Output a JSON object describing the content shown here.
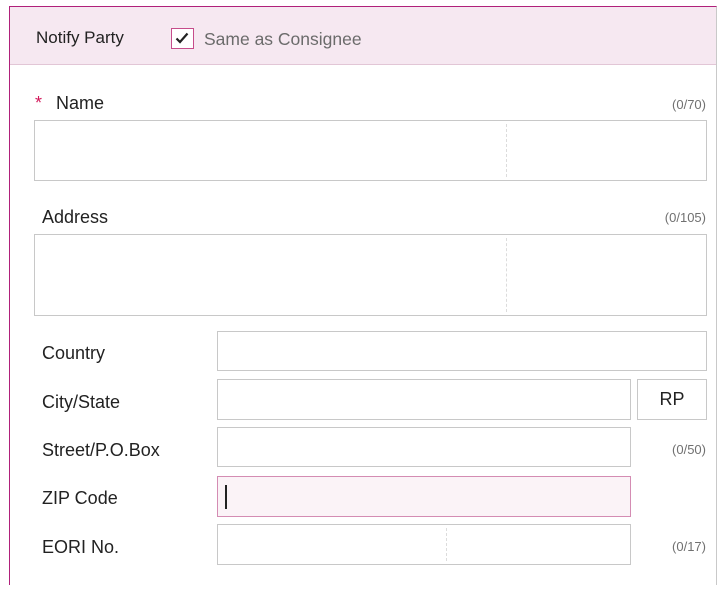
{
  "header": {
    "section_label": "Notify Party",
    "checkbox_label": "Same as Consignee",
    "checkbox_checked": true
  },
  "name": {
    "required_mark": "*",
    "label": "Name",
    "counter": "(0/70)",
    "value": ""
  },
  "address": {
    "label": "Address",
    "counter": "(0/105)",
    "value": ""
  },
  "country": {
    "label": "Country",
    "value": ""
  },
  "city_state": {
    "label": "City/State",
    "value": "",
    "state_value": "RP"
  },
  "street": {
    "label": "Street/P.O.Box",
    "counter": "(0/50)",
    "value": ""
  },
  "zip": {
    "label": "ZIP Code",
    "value": ""
  },
  "eori": {
    "label": "EORI No.",
    "counter": "(0/17)",
    "value": ""
  },
  "colors": {
    "accent": "#b0207a",
    "header_bg": "#f6e8f1",
    "required": "#d2185a",
    "focus_bg": "#fbf3f7"
  }
}
